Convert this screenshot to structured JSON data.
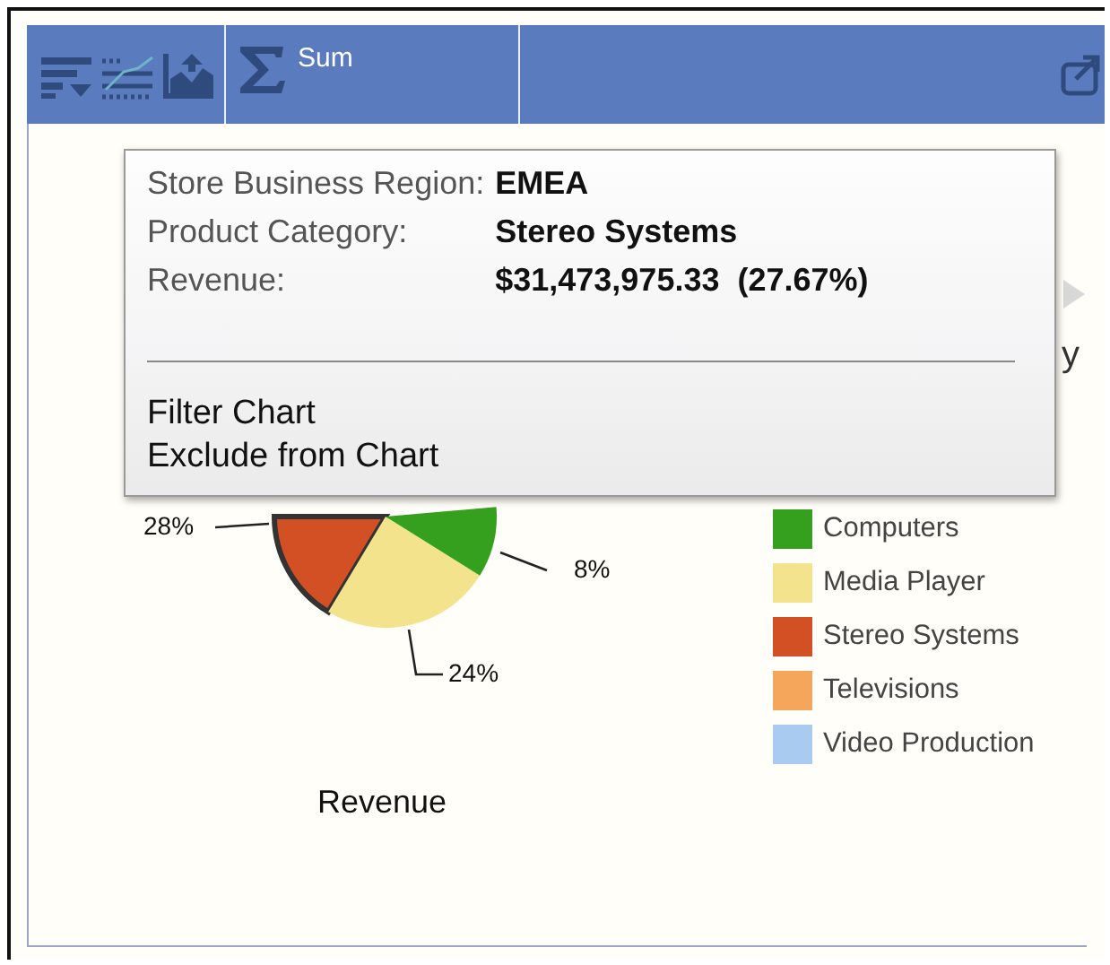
{
  "toolbar": {
    "aggregate_label": "Sum"
  },
  "chart": {
    "legend_title_fragment": "y",
    "axis_label": "Revenue",
    "slice_labels": [
      {
        "text": "28%",
        "color": "#d34f24",
        "highlighted": true
      },
      {
        "text": "24%",
        "color": "#f3e38c",
        "highlighted": false
      },
      {
        "text": "8%",
        "color": "#34a01e",
        "highlighted": false
      }
    ]
  },
  "legend": [
    {
      "label": "Computers",
      "color": "#34a01e"
    },
    {
      "label": "Media Player",
      "color": "#f3e38c"
    },
    {
      "label": "Stereo Systems",
      "color": "#d34f24"
    },
    {
      "label": "Televisions",
      "color": "#f6a65a"
    },
    {
      "label": "Video Production",
      "color": "#a9cbf0"
    }
  ],
  "tooltip": {
    "fields": [
      {
        "label": "Store Business Region:",
        "value": "EMEA"
      },
      {
        "label": "Product Category:",
        "value": "Stereo Systems"
      },
      {
        "label": "Revenue:",
        "value": "$31,473,975.33  (27.67%)"
      }
    ],
    "actions": [
      "Filter Chart",
      "Exclude from Chart"
    ]
  }
}
